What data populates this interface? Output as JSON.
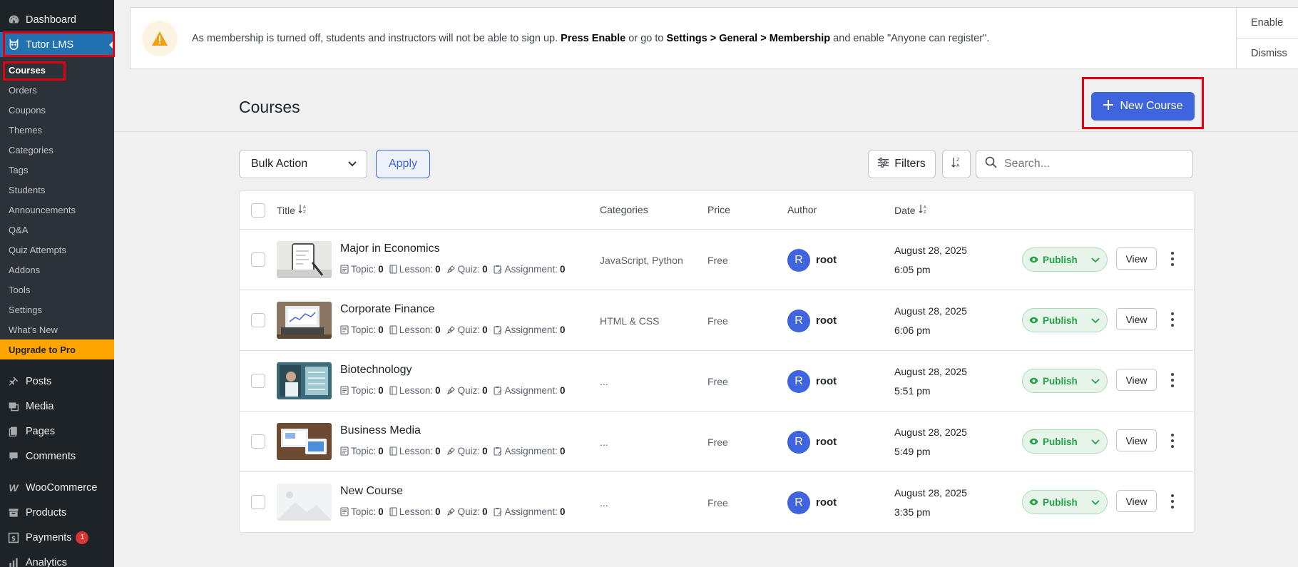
{
  "sidebar": {
    "top": [
      {
        "label": "Dashboard",
        "icon": "dashboard-icon"
      },
      {
        "label": "Tutor LMS",
        "icon": "tutor-owl-icon"
      }
    ],
    "tutor_submenu": [
      "Courses",
      "Orders",
      "Coupons",
      "Themes",
      "Categories",
      "Tags",
      "Students",
      "Announcements",
      "Q&A",
      "Quiz Attempts",
      "Addons",
      "Tools",
      "Settings",
      "What's New"
    ],
    "upgrade_label": "Upgrade to Pro",
    "bottom": [
      {
        "label": "Posts",
        "icon": "pin-icon"
      },
      {
        "label": "Media",
        "icon": "media-icon"
      },
      {
        "label": "Pages",
        "icon": "pages-icon"
      },
      {
        "label": "Comments",
        "icon": "comment-icon"
      },
      {
        "label": "WooCommerce",
        "icon": "woo-icon"
      },
      {
        "label": "Products",
        "icon": "archive-icon"
      },
      {
        "label": "Payments",
        "icon": "payments-icon",
        "badge": "1"
      },
      {
        "label": "Analytics",
        "icon": "chart-icon"
      }
    ]
  },
  "notice": {
    "text_1": "As membership is turned off, students and instructors will not be able to sign up. ",
    "bold_1": "Press Enable",
    "text_2": " or go to ",
    "bold_2": "Settings > General > Membership",
    "text_3": " and enable \"Anyone can register\".",
    "enable_label": "Enable",
    "dismiss_label": "Dismiss"
  },
  "header": {
    "title": "Courses",
    "new_course_label": "New Course"
  },
  "toolbar": {
    "bulk_action": "Bulk Action",
    "apply_label": "Apply",
    "filters_label": "Filters",
    "search_placeholder": "Search..."
  },
  "table": {
    "columns": {
      "title": "Title",
      "categories": "Categories",
      "price": "Price",
      "author": "Author",
      "date": "Date"
    },
    "meta_labels": {
      "topic": "Topic:",
      "lesson": "Lesson:",
      "quiz": "Quiz:",
      "assignment": "Assignment:"
    },
    "rows": [
      {
        "title": "Major in Economics",
        "topic": "0",
        "lesson": "0",
        "quiz": "0",
        "assignment": "0",
        "categories": "JavaScript, Python",
        "price": "Free",
        "author_initial": "R",
        "author": "root",
        "date": "August 28, 2025",
        "time": "6:05 pm",
        "status": "Publish",
        "view": "View",
        "thumb": "economics"
      },
      {
        "title": "Corporate Finance",
        "topic": "0",
        "lesson": "0",
        "quiz": "0",
        "assignment": "0",
        "categories": "HTML & CSS",
        "price": "Free",
        "author_initial": "R",
        "author": "root",
        "date": "August 28, 2025",
        "time": "6:06 pm",
        "status": "Publish",
        "view": "View",
        "thumb": "finance"
      },
      {
        "title": "Biotechnology",
        "topic": "0",
        "lesson": "0",
        "quiz": "0",
        "assignment": "0",
        "categories": "...",
        "price": "Free",
        "author_initial": "R",
        "author": "root",
        "date": "August 28, 2025",
        "time": "5:51 pm",
        "status": "Publish",
        "view": "View",
        "thumb": "biotech"
      },
      {
        "title": "Business Media",
        "topic": "0",
        "lesson": "0",
        "quiz": "0",
        "assignment": "0",
        "categories": "...",
        "price": "Free",
        "author_initial": "R",
        "author": "root",
        "date": "August 28, 2025",
        "time": "5:49 pm",
        "status": "Publish",
        "view": "View",
        "thumb": "media"
      },
      {
        "title": "New Course",
        "topic": "0",
        "lesson": "0",
        "quiz": "0",
        "assignment": "0",
        "categories": "...",
        "price": "Free",
        "author_initial": "R",
        "author": "root",
        "date": "August 28, 2025",
        "time": "3:35 pm",
        "status": "Publish",
        "view": "View",
        "thumb": "placeholder"
      }
    ]
  },
  "colors": {
    "sidebar_bg": "#1d2327",
    "wp_blue": "#2271b1",
    "tutor_blue": "#3e64de",
    "upgrade_orange": "#ffa500",
    "publish_green": "#24a148",
    "highlight_red": "#e3000f"
  }
}
